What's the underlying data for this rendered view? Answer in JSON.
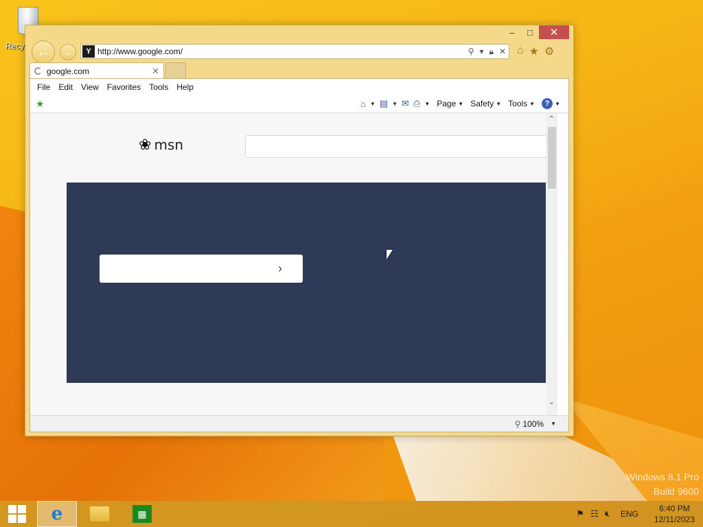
{
  "desktop": {
    "recycle_bin_label": "Recyc",
    "watermark_line1": "Windows 8.1 Pro",
    "watermark_line2": "Build 9600"
  },
  "browser": {
    "caption": {
      "minimize": "–",
      "maximize": "□",
      "close": "✕"
    },
    "address_url": "http://www.google.com/",
    "favicon_glyph": "Y",
    "tab": {
      "title": "google.com",
      "close": "✕"
    },
    "menu": [
      "File",
      "Edit",
      "View",
      "Favorites",
      "Tools",
      "Help"
    ],
    "command_bar": {
      "page": "Page",
      "safety": "Safety",
      "tools": "Tools",
      "help": "?"
    },
    "zoom": "100%"
  },
  "page": {
    "logo_text": "msn",
    "hero_button_arrow": "›"
  },
  "taskbar": {
    "language": "ENG",
    "time": "6:40 PM",
    "date": "12/11/2023"
  },
  "colors": {
    "hero_bg": "#2e3a56",
    "close_red": "#c74e4e",
    "window_frame": "#f5d98a"
  }
}
